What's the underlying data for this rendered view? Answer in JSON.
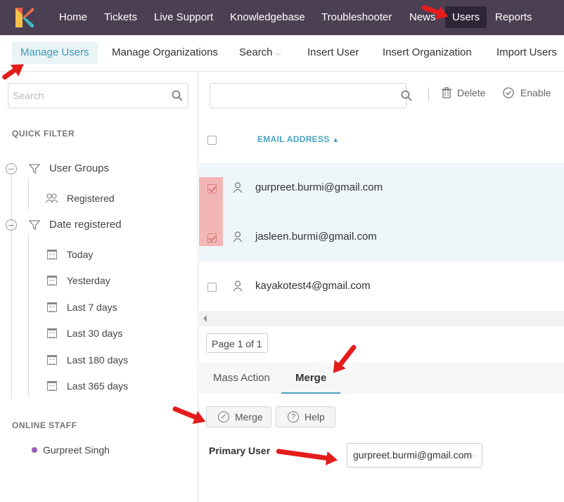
{
  "top_nav": {
    "items": [
      "Home",
      "Tickets",
      "Live Support",
      "Knowledgebase",
      "Troubleshooter",
      "News",
      "Users",
      "Reports"
    ],
    "active": "Users"
  },
  "sub_nav": {
    "items": [
      "Manage Users",
      "Manage Organizations",
      "Search",
      "Insert User",
      "Insert Organization",
      "Import Users"
    ],
    "active": "Manage Users"
  },
  "sidebar": {
    "search_placeholder": "Search",
    "quick_filter_title": "QUICK FILTER",
    "groups": [
      {
        "label": "User Groups",
        "children": [
          "Registered"
        ]
      },
      {
        "label": "Date registered",
        "children": [
          "Today",
          "Yesterday",
          "Last 7 days",
          "Last 30 days",
          "Last 180 days",
          "Last 365 days"
        ]
      }
    ],
    "online_staff_title": "ONLINE STAFF",
    "online_staff": [
      {
        "name": "Gurpreet Singh",
        "status_color": "#9b59b6"
      }
    ]
  },
  "toolbar": {
    "search_placeholder": "",
    "delete_label": "Delete",
    "enable_label": "Enable"
  },
  "table": {
    "column_header": "EMAIL ADDRESS",
    "sort": "ascending",
    "rows": [
      {
        "email": "gurpreet.burmi@gmail.com",
        "checked": true
      },
      {
        "email": "jasleen.burmi@gmail.com",
        "checked": true
      },
      {
        "email": "kayakotest4@gmail.com",
        "checked": false
      }
    ]
  },
  "pager": {
    "label": "Page 1 of 1"
  },
  "bottom_tabs": {
    "items": [
      "Mass Action",
      "Merge"
    ],
    "active": "Merge"
  },
  "merge_panel": {
    "merge_button": "Merge",
    "help_button": "Help",
    "primary_user_label": "Primary User",
    "primary_user_value": "gurpreet.burmi@gmail.com"
  },
  "colors": {
    "topbar": "#4b3f52",
    "accent": "#3b9ab5",
    "annotation_arrow": "#e51c1c",
    "selection_highlight": "#f4a0a0"
  }
}
